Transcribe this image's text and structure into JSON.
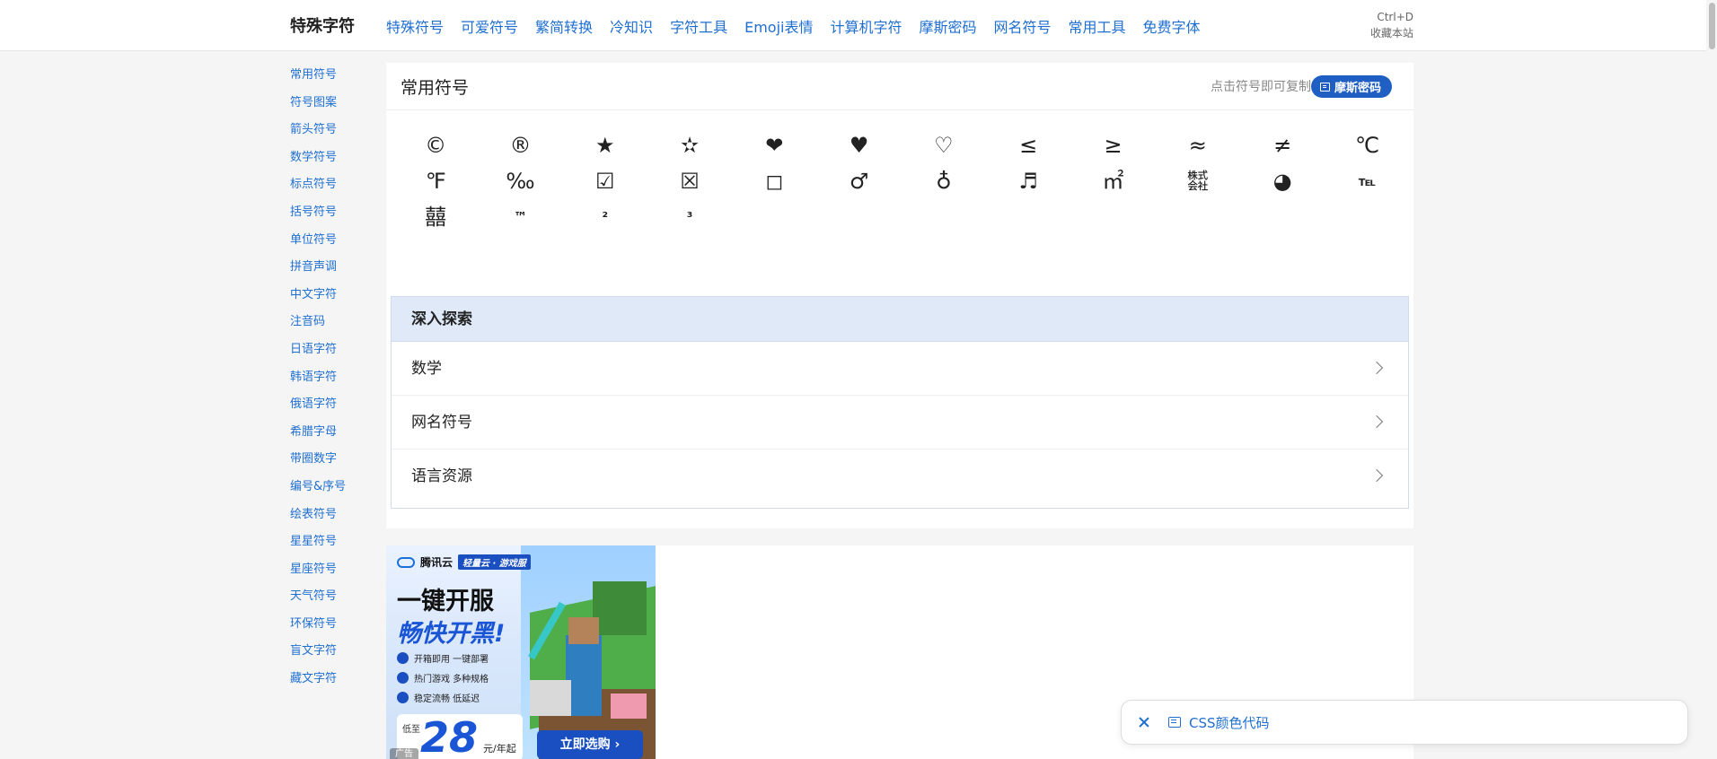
{
  "header": {
    "logo": "特殊字符",
    "nav": [
      "特殊符号",
      "可爱符号",
      "繁简转换",
      "冷知识",
      "字符工具",
      "Emoji表情",
      "计算机字符",
      "摩斯密码",
      "网名符号",
      "常用工具",
      "免费字体"
    ],
    "bookmark_shortcut": "Ctrl+D",
    "bookmark_label": "收藏本站"
  },
  "sidebar": {
    "items": [
      "常用符号",
      "符号图案",
      "箭头符号",
      "数学符号",
      "标点符号",
      "括号符号",
      "单位符号",
      "拼音声调",
      "中文字符",
      "注音码",
      "日语字符",
      "韩语字符",
      "俄语字符",
      "希腊字母",
      "带圈数字",
      "编号&序号",
      "绘表符号",
      "星星符号",
      "星座符号",
      "天气符号",
      "环保符号",
      "盲文字符",
      "藏文字符"
    ]
  },
  "main": {
    "title": "常用符号",
    "hint": "点击符号即可复制",
    "morse_button": "摩斯密码",
    "symbols": [
      "©",
      "®",
      "★",
      "✫",
      "❤",
      "♥",
      "♡",
      "≤",
      "≥",
      "≈",
      "≠",
      "℃",
      "℉",
      "‰",
      "☑",
      "☒",
      "◻",
      "♂",
      "♁",
      "♬",
      "㎡",
      "㍿",
      "◕",
      "℡",
      "囍",
      "™",
      "²",
      "³"
    ],
    "explore": {
      "heading": "深入探索",
      "items": [
        "数学",
        "网名符号",
        "语言资源"
      ]
    }
  },
  "ad": {
    "brand": "腾讯云",
    "tag": "轻量云 · 游戏服",
    "headline1": "一键开服",
    "headline2": "畅快开黑!",
    "features": [
      "开箱即用  一键部署",
      "热门游戏  多种规格",
      "稳定流畅  低延迟"
    ],
    "price_prefix": "低至",
    "price": "28",
    "price_unit": "元/年起",
    "cta": "立即选购 ›",
    "label": "广告"
  },
  "toast": {
    "link": "CSS颜色代码"
  },
  "colors": {
    "accent": "#1f6fd1",
    "button": "#1f5fc4",
    "explore_header_bg": "#dfe9f8"
  }
}
